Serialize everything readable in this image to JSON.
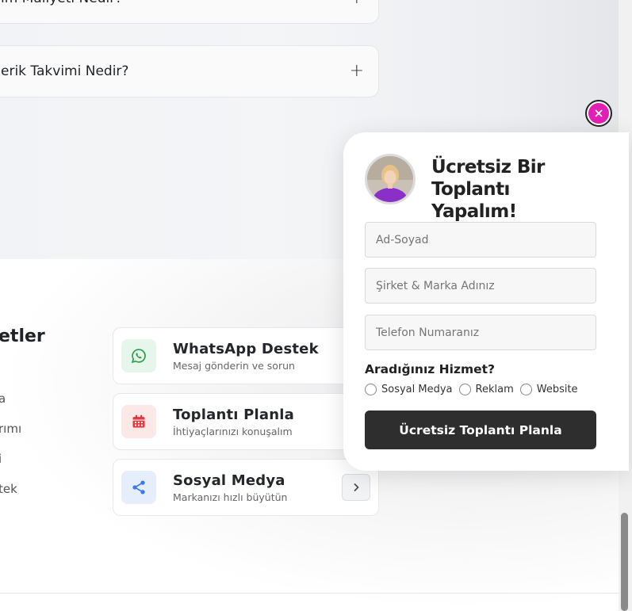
{
  "faq": [
    {
      "question": "ım Maliyeti Nedir?"
    },
    {
      "question": "erik Takvimi Nedir?"
    }
  ],
  "footer_column": {
    "title": "etler",
    "links": [
      "a",
      "rımı",
      "i",
      "tek"
    ]
  },
  "contact_cards": [
    {
      "title": "WhatsApp Destek",
      "subtitle": "Mesaj gönderin ve sorun",
      "icon": "whatsapp-icon",
      "icon_bg": "#e6f6ea",
      "icon_color": "#25a244"
    },
    {
      "title": "Toplantı Planla",
      "subtitle": "İhtiyaçlarınızı konuşalım",
      "icon": "calendar-icon",
      "icon_bg": "#fde8e8",
      "icon_color": "#e0383c"
    },
    {
      "title": "Sosyal Medya",
      "subtitle": "Markanızı hızlı büyütün",
      "icon": "share-icon",
      "icon_bg": "#e6eefc",
      "icon_color": "#3b7be8"
    }
  ],
  "popup": {
    "title": "Ücretsiz Bir Toplantı Yapalım!",
    "fields": [
      {
        "placeholder": "Ad-Soyad"
      },
      {
        "placeholder": "Şirket & Marka Adınız"
      },
      {
        "placeholder": "Telefon Numaranız"
      }
    ],
    "question": "Aradığınız Hizmet?",
    "options": [
      "Sosyal Medya",
      "Reklam",
      "Website"
    ],
    "submit_label": "Ücretsiz Toplantı Planla",
    "close_color": "#e21fb4"
  }
}
